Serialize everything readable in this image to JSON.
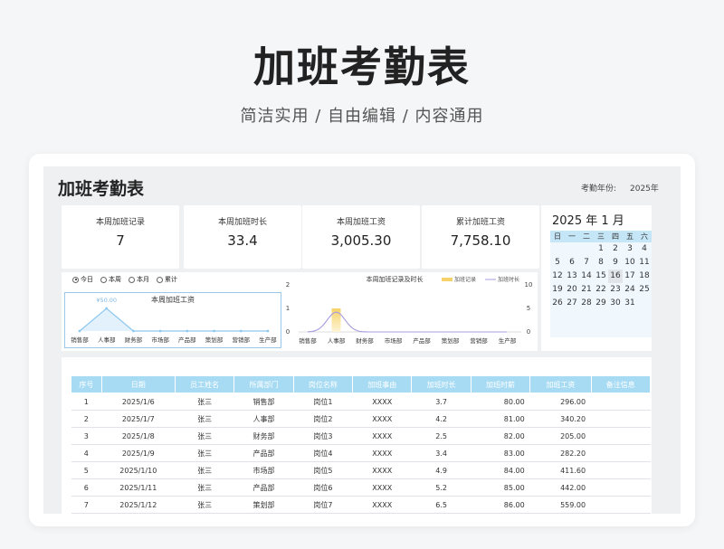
{
  "hero": {
    "title": "加班考勤表",
    "subtitle": "简洁实用 / 自由编辑 / 内容通用"
  },
  "sheet": {
    "title": "加班考勤表",
    "year_label": "考勤年份:",
    "year_value": "2025年"
  },
  "kpis": [
    {
      "label": "本周加班记录",
      "value": "7"
    },
    {
      "label": "本周加班时长",
      "value": "33.4"
    },
    {
      "label": "本周加班工资",
      "value": "3,005.30"
    },
    {
      "label": "累计加班工资",
      "value": "7,758.10"
    }
  ],
  "calendar": {
    "title": "2025 年  1 月",
    "weekdays": [
      "日",
      "一",
      "二",
      "三",
      "四",
      "五",
      "六"
    ],
    "weeks": [
      [
        "",
        "",
        "",
        "1",
        "2",
        "3",
        "4"
      ],
      [
        "5",
        "6",
        "7",
        "8",
        "9",
        "10",
        "11"
      ],
      [
        "12",
        "13",
        "14",
        "15",
        "16",
        "17",
        "18"
      ],
      [
        "19",
        "20",
        "21",
        "22",
        "23",
        "24",
        "25"
      ],
      [
        "26",
        "27",
        "28",
        "29",
        "30",
        "31",
        ""
      ]
    ],
    "highlight_day": "16"
  },
  "filters": {
    "options": [
      "今日",
      "本周",
      "本月",
      "累计"
    ],
    "selected": "今日"
  },
  "colors": {
    "header_bg": "#a7dbf3",
    "accent": "#8fc8ef",
    "bar": "#f5d36a",
    "curve": "#a79be0"
  },
  "chart_data": [
    {
      "type": "line",
      "title": "本周加班工资",
      "categories": [
        "销售部",
        "人事部",
        "财务部",
        "市场部",
        "产品部",
        "策划部",
        "营销部",
        "生产部"
      ],
      "values": [
        0,
        50,
        0,
        0,
        0,
        0,
        0,
        0
      ],
      "data_labels": {
        "人事部": "¥50.00"
      }
    },
    {
      "type": "bar",
      "title": "本周加班记录及时长",
      "categories": [
        "销售部",
        "人事部",
        "财务部",
        "市场部",
        "产品部",
        "策划部",
        "营销部",
        "生产部"
      ],
      "series": [
        {
          "name": "加班记录",
          "values": [
            0,
            1,
            0,
            0,
            0,
            0,
            0,
            0
          ]
        },
        {
          "name": "加班时长",
          "values": [
            0,
            4.2,
            0,
            0,
            0,
            0,
            0,
            0
          ]
        }
      ],
      "left_axis": {
        "ticks": [
          "2",
          "1",
          "0"
        ],
        "range": [
          0,
          2
        ]
      },
      "right_axis": {
        "ticks": [
          "10",
          "5",
          "0"
        ],
        "range": [
          0,
          10
        ]
      }
    }
  ],
  "table": {
    "columns": [
      "序号",
      "日期",
      "员工姓名",
      "所属部门",
      "岗位名称",
      "加班事由",
      "加班时长",
      "加班时薪",
      "加班工资",
      "备注信息"
    ],
    "rows": [
      [
        "1",
        "2025/1/6",
        "张三",
        "销售部",
        "岗位1",
        "XXXX",
        "3.7",
        "80.00",
        "296.00",
        ""
      ],
      [
        "2",
        "2025/1/7",
        "张三",
        "人事部",
        "岗位2",
        "XXXX",
        "4.2",
        "81.00",
        "340.20",
        ""
      ],
      [
        "3",
        "2025/1/8",
        "张三",
        "财务部",
        "岗位3",
        "XXXX",
        "2.5",
        "82.00",
        "205.00",
        ""
      ],
      [
        "4",
        "2025/1/9",
        "张三",
        "产品部",
        "岗位4",
        "XXXX",
        "3.4",
        "83.00",
        "282.20",
        ""
      ],
      [
        "5",
        "2025/1/10",
        "张三",
        "市场部",
        "岗位5",
        "XXXX",
        "4.9",
        "84.00",
        "411.60",
        ""
      ],
      [
        "6",
        "2025/1/11",
        "张三",
        "产品部",
        "岗位6",
        "XXXX",
        "5.2",
        "85.00",
        "442.00",
        ""
      ],
      [
        "7",
        "2025/1/12",
        "张三",
        "策划部",
        "岗位7",
        "XXXX",
        "6.5",
        "86.00",
        "559.00",
        ""
      ]
    ]
  }
}
